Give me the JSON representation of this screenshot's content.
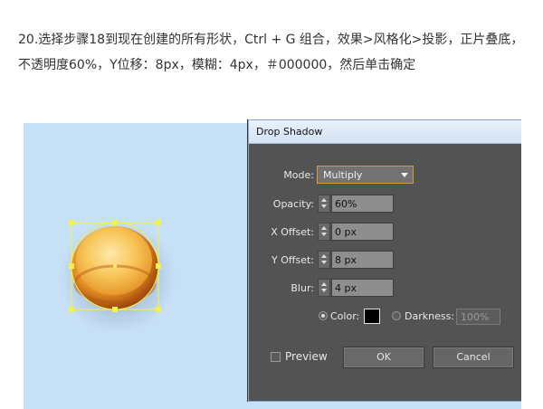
{
  "instruction": {
    "text": "20.选择步骤18到现在创建的所有形状，Ctrl + G 组合，效果>风格化>投影，正片叠底，不透明度60%，Y位移：8px，模糊：4px，＃000000，然后单击确定"
  },
  "dialog": {
    "title": "Drop Shadow",
    "mode": {
      "label": "Mode:",
      "value": "Multiply"
    },
    "opacity": {
      "label": "Opacity:",
      "value": "60%"
    },
    "x_offset": {
      "label": "X Offset:",
      "value": "0 px"
    },
    "y_offset": {
      "label": "Y Offset:",
      "value": "8 px"
    },
    "blur": {
      "label": "Blur:",
      "value": "4 px"
    },
    "color": {
      "label": "Color:",
      "swatch": "#000000",
      "selected": true
    },
    "darkness": {
      "label": "Darkness:",
      "value": "100%",
      "selected": false
    },
    "preview": {
      "label": "Preview",
      "checked": false
    },
    "ok_label": "OK",
    "cancel_label": "Cancel"
  },
  "colors": {
    "canvas_bg": "#c6e0f8",
    "dialog_bg": "#535353",
    "selection": "#f6f04a",
    "orb_light": "#fbd77e",
    "orb_dark": "#b8540c"
  }
}
